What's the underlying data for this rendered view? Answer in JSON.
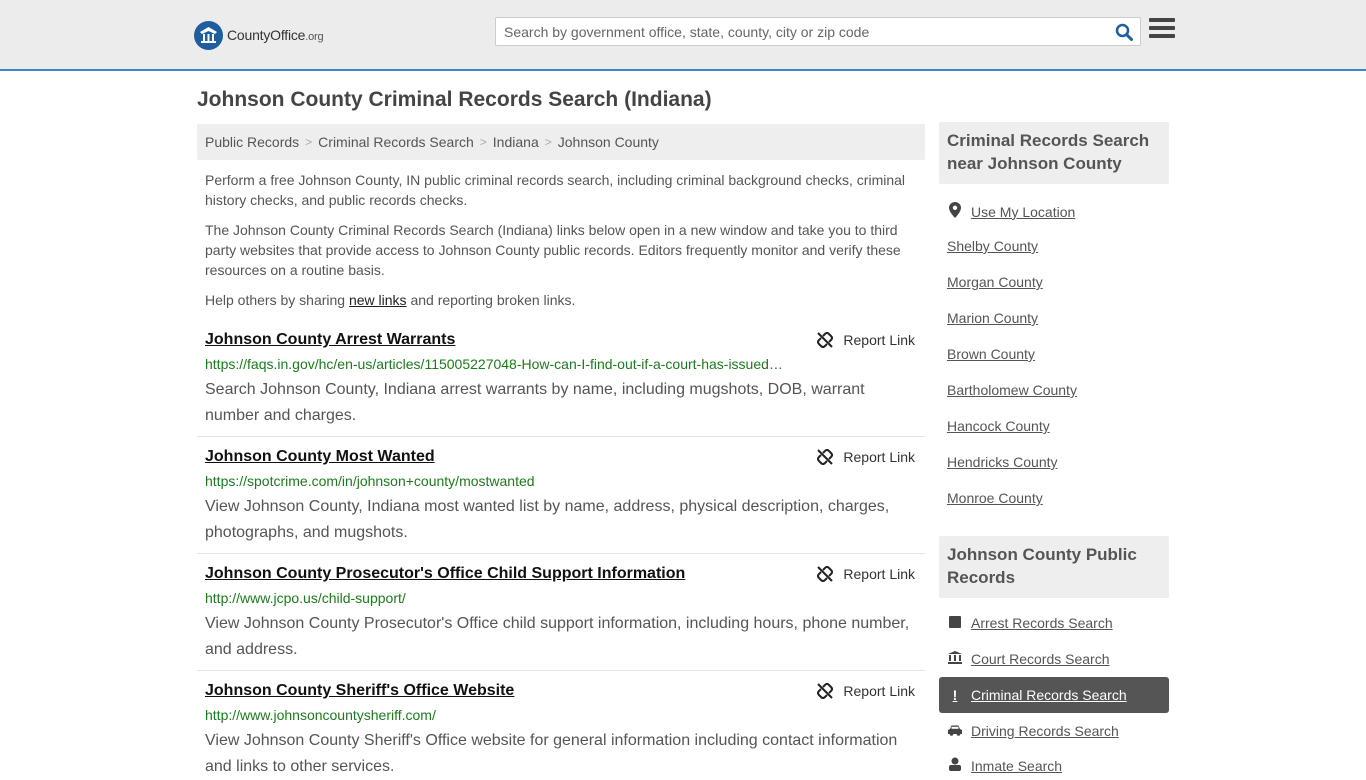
{
  "header": {
    "logo_brand": "CountyOffice",
    "logo_tld": ".org",
    "search_placeholder": "Search by government office, state, county, city or zip code"
  },
  "page_title": "Johnson County Criminal Records Search (Indiana)",
  "breadcrumb": [
    "Public Records",
    "Criminal Records Search",
    "Indiana",
    "Johnson County"
  ],
  "intro": {
    "p1": "Perform a free Johnson County, IN public criminal records search, including criminal background checks, criminal history checks, and public records checks.",
    "p2": "The Johnson County Criminal Records Search (Indiana) links below open in a new window and take you to third party websites that provide access to Johnson County public records. Editors frequently monitor and verify these resources on a routine basis.",
    "p3_before": "Help others by sharing ",
    "p3_link": "new links",
    "p3_after": " and reporting broken links."
  },
  "report_label": "Report Link",
  "results": [
    {
      "title": "Johnson County Arrest Warrants",
      "url": "https://faqs.in.gov/hc/en-us/articles/115005227048-How-can-I-find-out-if-a-court-has-issued…",
      "desc": "Search Johnson County, Indiana arrest warrants by name, including mugshots, DOB, warrant number and charges."
    },
    {
      "title": "Johnson County Most Wanted",
      "url": "https://spotcrime.com/in/johnson+county/mostwanted",
      "desc": "View Johnson County, Indiana most wanted list by name, address, physical description, charges, photographs, and mugshots."
    },
    {
      "title": "Johnson County Prosecutor's Office Child Support Information",
      "url": "http://www.jcpo.us/child-support/",
      "desc": "View Johnson County Prosecutor's Office child support information, including hours, phone number, and address."
    },
    {
      "title": "Johnson County Sheriff's Office Website",
      "url": "http://www.johnsoncountysheriff.com/",
      "desc": "View Johnson County Sheriff's Office website for general information including contact information and links to other services."
    }
  ],
  "sidebar": {
    "nearby_heading": "Criminal Records Search near Johnson County",
    "use_location": "Use My Location",
    "nearby": [
      "Shelby County",
      "Morgan County",
      "Marion County",
      "Brown County",
      "Bartholomew County",
      "Hancock County",
      "Hendricks County",
      "Monroe County"
    ],
    "public_heading": "Johnson County Public Records",
    "public_links": [
      {
        "label": "Arrest Records Search",
        "icon": "square-icon"
      },
      {
        "label": "Court Records Search",
        "icon": "courthouse-icon"
      },
      {
        "label": "Criminal Records Search",
        "icon": "exclamation-icon"
      },
      {
        "label": "Driving Records Search",
        "icon": "car-icon"
      },
      {
        "label": "Inmate Search",
        "icon": "inmate-icon"
      }
    ]
  }
}
